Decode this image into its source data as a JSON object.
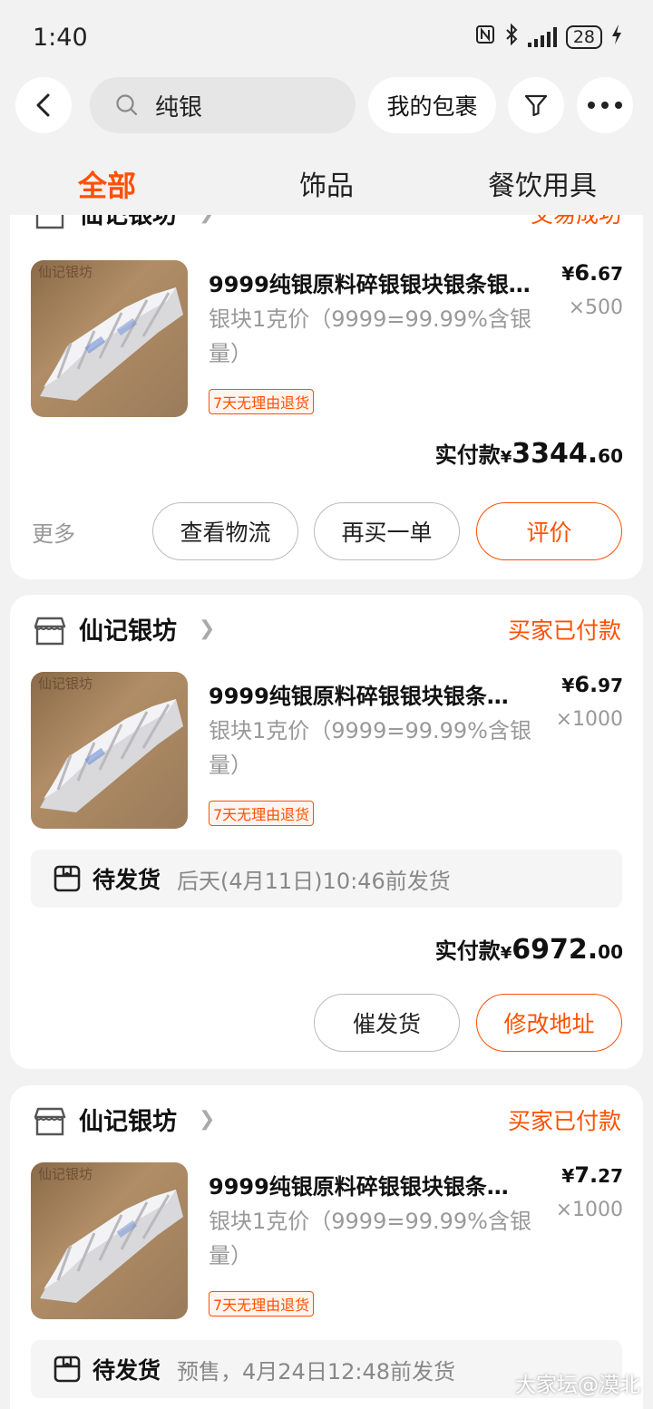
{
  "status_bar": {
    "time": "1:40",
    "battery": "28"
  },
  "header": {
    "search_text": "纯银",
    "packages_button": "我的包裹"
  },
  "tabs": [
    "全部",
    "饰品",
    "餐饮用具"
  ],
  "orders": [
    {
      "shop": "仙记银坊",
      "status": "交易成功",
      "title": "9999纯银原料碎银银块银条银…",
      "spec": "银块1克价（9999=99.99%含银量）",
      "tag": "7天无理由退货",
      "price_symbol": "¥",
      "price_int": "6.",
      "price_dec": "67",
      "qty": "×500",
      "paid_label": "实付款",
      "paid_symbol": "¥",
      "paid_int": "3344.",
      "paid_dec": "60",
      "more": "更多",
      "buttons": [
        "查看物流",
        "再买一单",
        "评价"
      ]
    },
    {
      "shop": "仙记银坊",
      "status": "买家已付款",
      "title": "9999纯银原料碎银银块银条…",
      "spec": "银块1克价（9999=99.99%含银量）",
      "tag": "7天无理由退货",
      "price_symbol": "¥",
      "price_int": "6.",
      "price_dec": "97",
      "qty": "×1000",
      "ship_label": "待发货",
      "ship_text": "后天(4月11日)10:46前发货",
      "paid_label": "实付款",
      "paid_symbol": "¥",
      "paid_int": "6972.",
      "paid_dec": "00",
      "buttons": [
        "催发货",
        "修改地址"
      ]
    },
    {
      "shop": "仙记银坊",
      "status": "买家已付款",
      "title": "9999纯银原料碎银银块银条…",
      "spec": "银块1克价（9999=99.99%含银量）",
      "tag": "7天无理由退货",
      "price_symbol": "¥",
      "price_int": "7.",
      "price_dec": "27",
      "qty": "×1000",
      "ship_label": "待发货",
      "ship_text": "预售，4月24日12:48前发货"
    }
  ],
  "thumb_watermark": "仙记银坊",
  "watermark": "大家坛@漠北",
  "colors": {
    "accent": "#ff5000",
    "background": "#f2f2f2"
  }
}
